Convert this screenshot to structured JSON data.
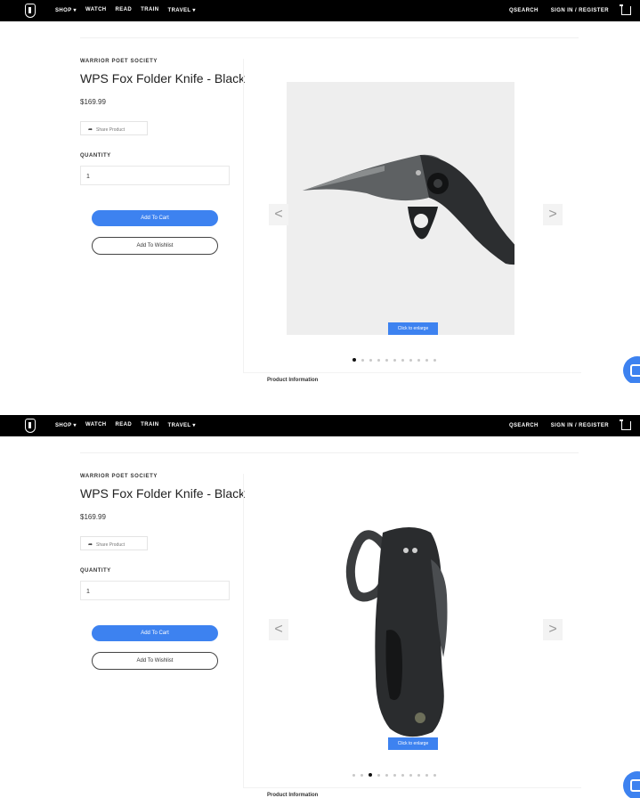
{
  "nav": {
    "links": [
      "SHOP ▾",
      "WATCH",
      "READ",
      "TRAIN",
      "TRAVEL ▾"
    ],
    "search": "SEARCH",
    "account": "SIGN IN / REGISTER"
  },
  "product": {
    "brand": "WARRIOR POET SOCIETY",
    "title": "WPS Fox Folder Knife - Black",
    "price": "$169.99",
    "share_label": "Share Product",
    "quantity_label": "QUANTITY",
    "quantity_value": "1",
    "add_to_cart": "Add To Cart",
    "add_to_wishlist": "Add To Wishlist"
  },
  "gallery": {
    "zoom_label": "Click to enlarge",
    "prev": "<",
    "next": ">",
    "image_count": 11,
    "screens": [
      {
        "active_index": 0,
        "view": "knife-open-side"
      },
      {
        "active_index": 2,
        "view": "knife-closed-top"
      }
    ]
  },
  "below_label": "Product Information",
  "colors": {
    "accent": "#3d82f0",
    "nav_bg": "#000000",
    "image_bg": "#eeeeee"
  }
}
